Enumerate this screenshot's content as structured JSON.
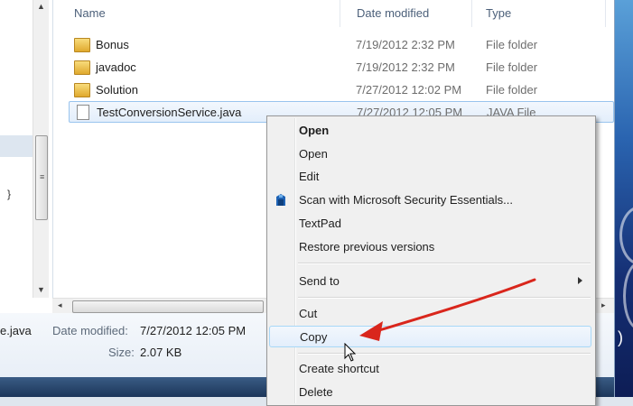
{
  "columns": {
    "name": "Name",
    "date_modified": "Date modified",
    "type": "Type"
  },
  "files": [
    {
      "name": "Bonus",
      "date": "7/19/2012 2:32 PM",
      "type": "File folder",
      "icon": "folder-icon"
    },
    {
      "name": "javadoc",
      "date": "7/19/2012 2:32 PM",
      "type": "File folder",
      "icon": "folder-icon"
    },
    {
      "name": "Solution",
      "date": "7/27/2012 12:02 PM",
      "type": "File folder",
      "icon": "folder-icon"
    },
    {
      "name": "TestConversionService.java",
      "date": "7/27/2012 12:05 PM",
      "type": "JAVA File",
      "icon": "file-icon"
    }
  ],
  "details": {
    "file_name_partial": "e.java",
    "date_modified_label": "Date modified:",
    "date_modified_value": "7/27/2012 12:05 PM",
    "size_label": "Size:",
    "size_value": "2.07 KB"
  },
  "context_menu": {
    "open_bold": "Open",
    "open": "Open",
    "edit": "Edit",
    "scan": "Scan with Microsoft Security Essentials...",
    "textpad": "TextPad",
    "restore": "Restore previous versions",
    "send_to": "Send to",
    "cut": "Cut",
    "copy": "Copy",
    "create_shortcut": "Create shortcut",
    "delete": "Delete"
  },
  "colors": {
    "annotation_arrow": "#d9261c",
    "selection_border": "#99c4ee",
    "menu_background": "#f0f0f0"
  }
}
